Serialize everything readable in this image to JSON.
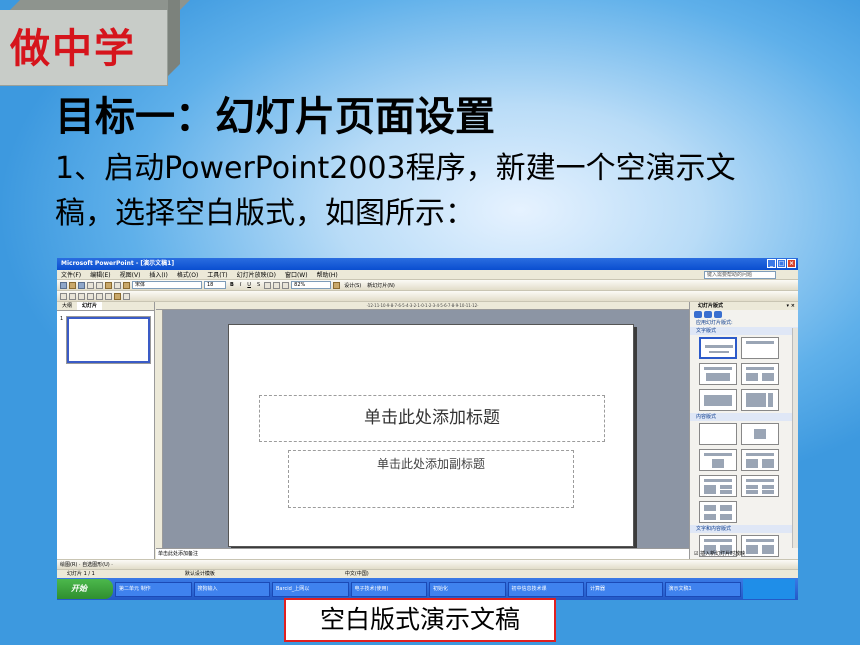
{
  "badge": {
    "label": "做中学"
  },
  "heading": {
    "title": "目标一：幻灯片页面设置"
  },
  "step": {
    "text": "1、启动PowerPoint2003程序，新建一个空演示文稿，选择空白版式，如图所示："
  },
  "caption": {
    "text": "空白版式演示文稿"
  },
  "screenshot": {
    "window_title": "Microsoft PowerPoint - [演示文稿1]",
    "menus": [
      "文件(F)",
      "编辑(E)",
      "视图(V)",
      "插入(I)",
      "格式(O)",
      "工具(T)",
      "幻灯片放映(D)",
      "窗口(W)",
      "帮助(H)"
    ],
    "help_placeholder": "键入需要帮助的问题",
    "toolbar": {
      "font": "宋体",
      "size": "18",
      "zoom": "82%",
      "design": "设计(S)",
      "new_slide": "新幻灯片(N)"
    },
    "left_pane": {
      "tab_outline": "大纲",
      "tab_slides": "幻灯片",
      "slide_number": "1"
    },
    "ruler": "·12·11·10·9·8·7·6·5·4·3·2·1·0·1·2·3·4·5·6·7·8·9·10·11·12·",
    "slide": {
      "title_placeholder": "单击此处添加标题",
      "subtitle_placeholder": "单击此处添加副标题"
    },
    "notes": "单击此处添加备注",
    "task_pane": {
      "title": "幻灯片版式",
      "apply_label": "应用幻灯片版式:",
      "section_text": "文字版式",
      "section_content": "内容版式",
      "section_text_content": "文字和内容版式",
      "footer_checkbox": "插入新幻灯片时放映"
    },
    "drawbar": "绘图(R) · 自选图形(U) ·",
    "status": {
      "slide": "幻灯片 1 / 1",
      "template": "默认设计模板",
      "language": "中文(中国)"
    },
    "taskbar": {
      "start": "开始",
      "items": [
        "第二单元 制作",
        "搜狗输入",
        "Barcid_上网以",
        "电子技术(使用)",
        "初始化",
        "初中信息技术课",
        "计算器",
        "演示文稿1"
      ]
    }
  }
}
